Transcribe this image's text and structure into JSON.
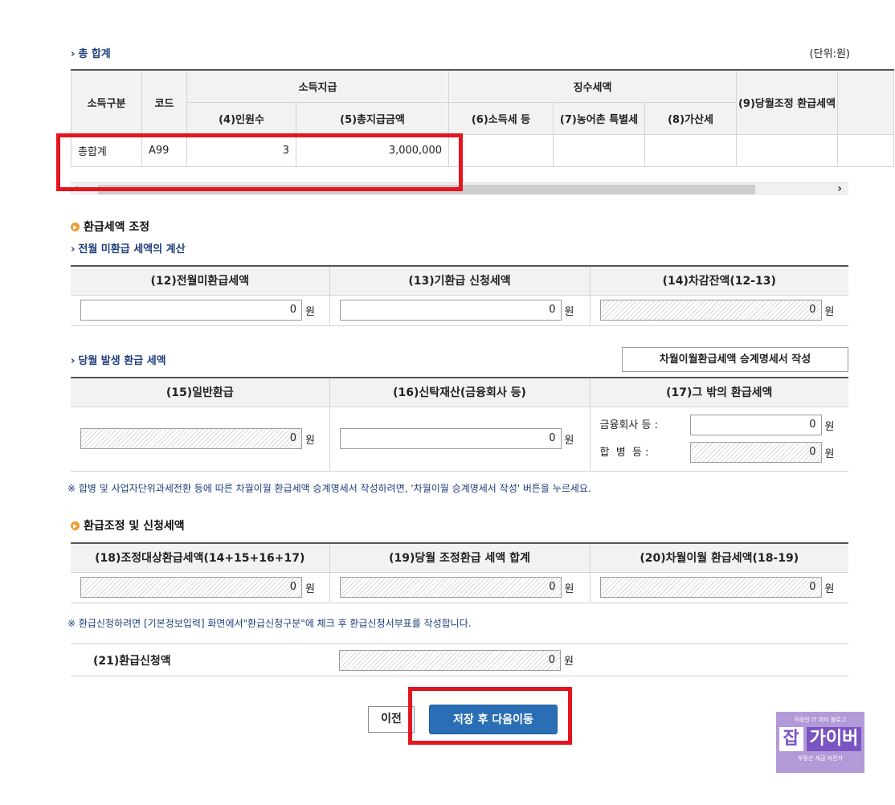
{
  "total": {
    "heading": "총 합계",
    "unit": "(단위:원)",
    "headers": {
      "income_type": "소득구분",
      "code": "코드",
      "income_payment": "소득지급",
      "tax_withheld": "징수세액",
      "headcount": "(4)인원수",
      "total_paid": "(5)총지급금액",
      "income_tax": "(6)소득세 등",
      "rural_tax": "(7)농어촌 특별세",
      "surcharge": "(8)가산세",
      "refund_adjust": "(9)당월조정 환급세액"
    },
    "row": {
      "income_type": "총합계",
      "code": "A99",
      "headcount": "3",
      "total_paid": "3,000,000",
      "income_tax": "",
      "rural_tax": "",
      "surcharge": "",
      "refund_adjust": ""
    }
  },
  "refund_adjust": {
    "heading": "환급세액 조정",
    "subheading": "전월 미환급 세액의 계산",
    "headers": [
      "(12)전월미환급세액",
      "(13)기환급 신청세액",
      "(14)차감잔액(12-13)"
    ],
    "values": [
      "0",
      "0",
      "0"
    ],
    "won": "원"
  },
  "current_refund": {
    "subheading": "당월 발생 환급 세액",
    "button": "차월이월환급세액 승계명세서 작성",
    "headers": [
      "(15)일반환급",
      "(16)신탁재산(금융회사 등)",
      "(17)그 밖의 환급세액"
    ],
    "general": "0",
    "trust": "0",
    "financial_label": "금융회사 등 :",
    "financial_value": "0",
    "merger_label": "합  병  등 :",
    "merger_value": "0",
    "won": "원",
    "note": "※ 합병 및 사업자단위과세전환 등에 따른 차월이월 환급세액 승계명세서 작성하려면, '차월이월 승계명세서 작성' 버튼을 누르세요."
  },
  "refund_request": {
    "heading": "환급조정 및 신청세액",
    "headers": [
      "(18)조정대상환급세액(14+15+16+17)",
      "(19)당월 조정환급 세액 합계",
      "(20)차월이월 환급세액(18-19)"
    ],
    "values": [
      "0",
      "0",
      "0"
    ],
    "won": "원",
    "note": "※ 환급신청하려면 [기본정보입력] 화면에서\"환급신청구분\"에 체크 후 환급신청서부표를 작성합니다.",
    "request_label": "(21)환급신청액",
    "request_value": "0"
  },
  "buttons": {
    "prev": "이전",
    "next": "저장 후 다음이동"
  },
  "logo": {
    "top": "직장인 IT 취미 블로그",
    "char": "잡",
    "name": "가이버",
    "bottom": "부동산 세금 자전거"
  },
  "colors": {
    "highlight": "#e3151e",
    "primary_button": "#2a6fb5",
    "note_text": "#1f3f7a"
  }
}
